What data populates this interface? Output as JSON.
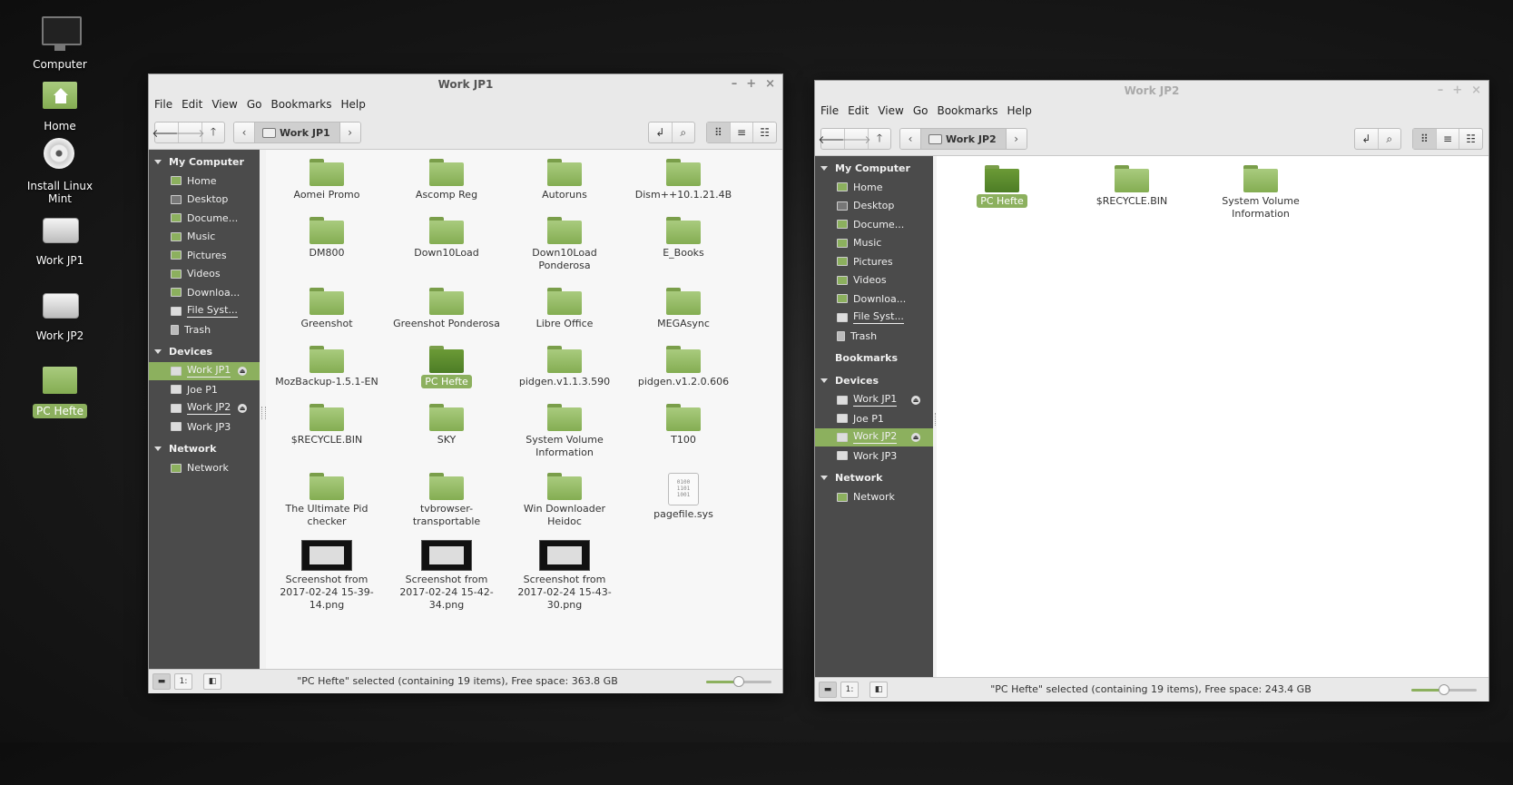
{
  "desktop": {
    "icons": [
      {
        "label": "Computer",
        "icon": "monitor-icon"
      },
      {
        "label": "Home",
        "icon": "home-folder-icon"
      },
      {
        "label": "Install Linux Mint",
        "icon": "disc-icon"
      },
      {
        "label": "Work JP1",
        "icon": "drive-icon"
      },
      {
        "label": "Work JP2",
        "icon": "drive-icon"
      },
      {
        "label": "PC Hefte",
        "icon": "folder-icon"
      }
    ]
  },
  "win1": {
    "title": "Work JP1",
    "menu": [
      "File",
      "Edit",
      "View",
      "Go",
      "Bookmarks",
      "Help"
    ],
    "location": "Work JP1",
    "sidebar": {
      "my_computer": "My Computer",
      "places": [
        "Home",
        "Desktop",
        "Docume...",
        "Music",
        "Pictures",
        "Videos",
        "Downloa...",
        "File Syst...",
        "Trash"
      ],
      "devices_header": "Devices",
      "devices": [
        "Work JP1",
        "Joe P1",
        "Work JP2",
        "Work JP3"
      ],
      "network_header": "Network",
      "network": [
        "Network"
      ]
    },
    "files": [
      "Aomei Promo",
      "Ascomp Reg",
      "Autoruns",
      "Dism++10.1.21.4B",
      "DM800",
      "Down10Load",
      "Down10Load Ponderosa",
      "E_Books",
      "Greenshot",
      "Greenshot Ponderosa",
      "Libre Office",
      "MEGAsync",
      "MozBackup-1.5.1-EN",
      "PC Hefte",
      "pidgen.v1.1.3.590",
      "pidgen.v1.2.0.606",
      "$RECYCLE.BIN",
      "SKY",
      "System Volume Information",
      "T100",
      "The Ultimate Pid checker",
      "tvbrowser-transportable",
      "Win Downloader Heidoc",
      "pagefile.sys",
      "Screenshot from 2017-02-24 15-39-14.png",
      "Screenshot from 2017-02-24 15-42-34.png",
      "Screenshot from 2017-02-24 15-43-30.png"
    ],
    "status": "\"PC Hefte\" selected (containing 19 items), Free space: 363.8 GB",
    "zoom": 0.5
  },
  "win2": {
    "title": "Work JP2",
    "menu": [
      "File",
      "Edit",
      "View",
      "Go",
      "Bookmarks",
      "Help"
    ],
    "location": "Work JP2",
    "sidebar": {
      "my_computer": "My Computer",
      "places": [
        "Home",
        "Desktop",
        "Docume...",
        "Music",
        "Pictures",
        "Videos",
        "Downloa...",
        "File Syst...",
        "Trash"
      ],
      "bookmarks_header": "Bookmarks",
      "devices_header": "Devices",
      "devices": [
        "Work JP1",
        "Joe P1",
        "Work JP2",
        "Work JP3"
      ],
      "network_header": "Network",
      "network": [
        "Network"
      ]
    },
    "files": [
      "PC Hefte",
      "$RECYCLE.BIN",
      "System Volume Information"
    ],
    "status": "\"PC Hefte\" selected (containing 19 items), Free space: 243.4 GB",
    "zoom": 0.5
  },
  "colors": {
    "accent": "#8cb05e",
    "sidebar": "#4b4b4b"
  }
}
